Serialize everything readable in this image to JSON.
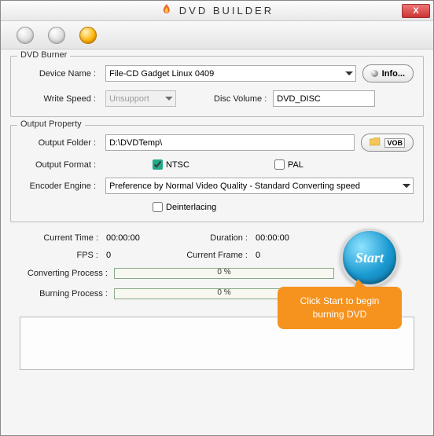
{
  "window": {
    "title": "DVD BUILDER",
    "close": "X"
  },
  "burner": {
    "legend": "DVD Burner",
    "device_label": "Device Name :",
    "device_value": "File-CD Gadget   Linux   0409",
    "info_button": "Info...",
    "write_speed_label": "Write Speed :",
    "write_speed_value": "Unsupport",
    "disc_volume_label": "Disc Volume :",
    "disc_volume_value": "DVD_DISC"
  },
  "output": {
    "legend": "Output Property",
    "folder_label": "Output Folder :",
    "folder_value": "D:\\DVDTemp\\",
    "vob_button": "VOB",
    "format_label": "Output Format :",
    "ntsc_label": "NTSC",
    "ntsc_checked": true,
    "pal_label": "PAL",
    "pal_checked": false,
    "encoder_label": "Encoder Engine :",
    "encoder_value": "Preference by Normal Video Quality - Standard Converting speed",
    "deinterlace_label": "Deinterlacing",
    "deinterlace_checked": false
  },
  "stats": {
    "current_time_label": "Current Time :",
    "current_time_value": "00:00:00",
    "duration_label": "Duration :",
    "duration_value": "00:00:00",
    "fps_label": "FPS :",
    "fps_value": "0",
    "current_frame_label": "Current Frame :",
    "current_frame_value": "0",
    "converting_label": "Converting Process :",
    "converting_pct": "0 %",
    "burning_label": "Burning Process :",
    "burning_pct": "0 %",
    "start_label": "Start"
  },
  "callout": "Click Start to begin burning DVD"
}
